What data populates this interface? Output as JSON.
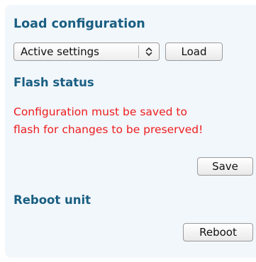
{
  "load_configuration": {
    "heading": "Load configuration",
    "select": {
      "selected": "Active settings"
    },
    "load_button": "Load"
  },
  "flash_status": {
    "heading": "Flash status",
    "message_line1": "Configuration must be saved to",
    "message_line2": "flash for changes to be preserved!",
    "save_button": "Save"
  },
  "reboot": {
    "heading": "Reboot unit",
    "reboot_button": "Reboot"
  },
  "colors": {
    "heading": "#1a5f82",
    "warning": "#ee1c1c",
    "panel_background": "#f2f7fc"
  },
  "icons": {
    "select_arrows": "up-down-chevron-icon"
  }
}
